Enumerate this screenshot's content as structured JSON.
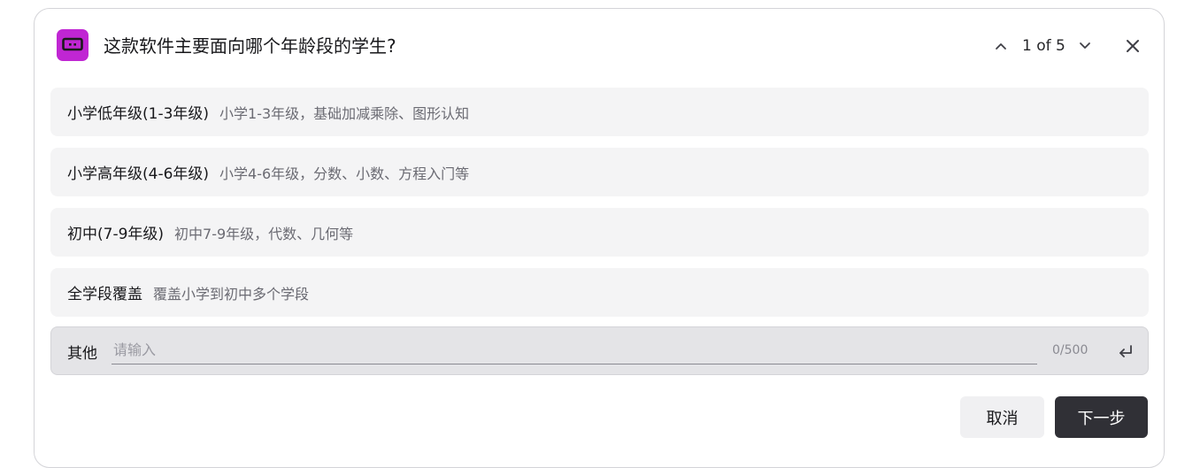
{
  "dialog": {
    "question": "这款软件主要面向哪个年龄段的学生?",
    "pager": {
      "text": "1 of 5"
    },
    "icons": {
      "app": "chat-bubble-icon",
      "prev": "chevron-up-icon",
      "next": "chevron-down-icon",
      "close": "close-icon",
      "submit": "enter-return-icon"
    },
    "accent_color": "#c026d3"
  },
  "options": [
    {
      "label": "小学低年级(1-3年级)",
      "desc": "小学1-3年级，基础加减乘除、图形认知"
    },
    {
      "label": "小学高年级(4-6年级)",
      "desc": "小学4-6年级，分数、小数、方程入门等"
    },
    {
      "label": "初中(7-9年级)",
      "desc": "初中7-9年级，代数、几何等"
    },
    {
      "label": "全学段覆盖",
      "desc": "覆盖小学到初中多个学段"
    }
  ],
  "other": {
    "label": "其他",
    "value": "",
    "placeholder": "请输入",
    "counter": "0/500"
  },
  "footer": {
    "cancel_label": "取消",
    "next_label": "下一步",
    "next_color": "#303036"
  }
}
